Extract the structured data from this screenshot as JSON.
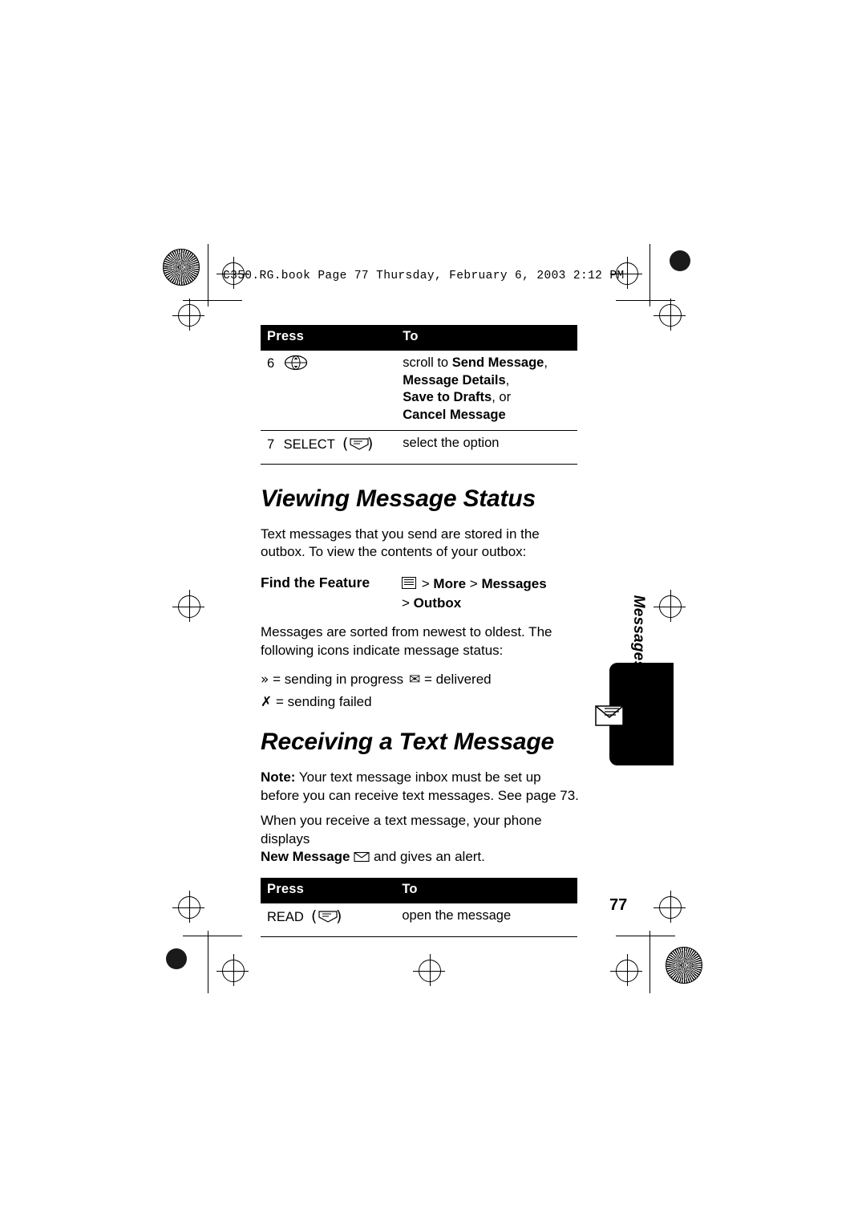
{
  "header": {
    "text": "C350.RG.book  Page 77  Thursday, February 6, 2003  2:12 PM"
  },
  "table_top": {
    "headers": [
      "Press",
      "To"
    ],
    "rows": [
      {
        "num": "6",
        "key_icon": "navigation-key-icon",
        "to_lines": [
          {
            "prefix": "scroll to ",
            "bold": "Send Message",
            "suffix": ","
          },
          {
            "prefix": "",
            "bold": "Message Details",
            "suffix": ","
          },
          {
            "prefix": "",
            "bold": "Save to Drafts",
            "suffix": ", or"
          },
          {
            "prefix": "",
            "bold": "Cancel Message",
            "suffix": ""
          }
        ]
      },
      {
        "num": "7",
        "key_label": "SELECT",
        "key_icon": "soft-key-icon",
        "to_lines": [
          {
            "prefix": "select the option",
            "bold": "",
            "suffix": ""
          }
        ]
      }
    ]
  },
  "section_1": {
    "title": "Viewing Message Status",
    "paragraph": "Text messages that you send are stored in the outbox. To view the contents of your outbox:",
    "find_feature": {
      "label": "Find the Feature",
      "menu_icon": "menu-key-icon",
      "path_line1_sep1": ">",
      "path_line1_item1": "More",
      "path_line1_sep2": ">",
      "path_line1_item2": "Messages",
      "path_line2_sep": ">",
      "path_line2_item": "Outbox"
    },
    "paragraph_2": "Messages are sorted from newest to oldest. The following icons indicate message status:",
    "status_icons": [
      {
        "glyph": "»",
        "label": "= sending in progress",
        "name": "sending-in-progress-icon"
      },
      {
        "glyph": "✉",
        "label": "= delivered",
        "name": "delivered-icon"
      },
      {
        "glyph": "✗",
        "label": "= sending failed",
        "name": "sending-failed-icon"
      }
    ]
  },
  "section_2": {
    "title": "Receiving a Text Message",
    "note_bold": "Note:",
    "note_text": " Your text message inbox must be set up before you can receive text messages. See page 73.",
    "paragraph": "When you receive a text message, your phone displays",
    "paragraph_bold": "New Message",
    "paragraph_tail": " and gives an alert."
  },
  "table_bottom": {
    "headers": [
      "Press",
      "To"
    ],
    "rows": [
      {
        "key_label": "READ",
        "key_icon": "soft-key-icon",
        "to": "open the message"
      }
    ]
  },
  "side_tab": {
    "label": "Messages",
    "icon": "envelope-icon"
  },
  "page_number": "77"
}
